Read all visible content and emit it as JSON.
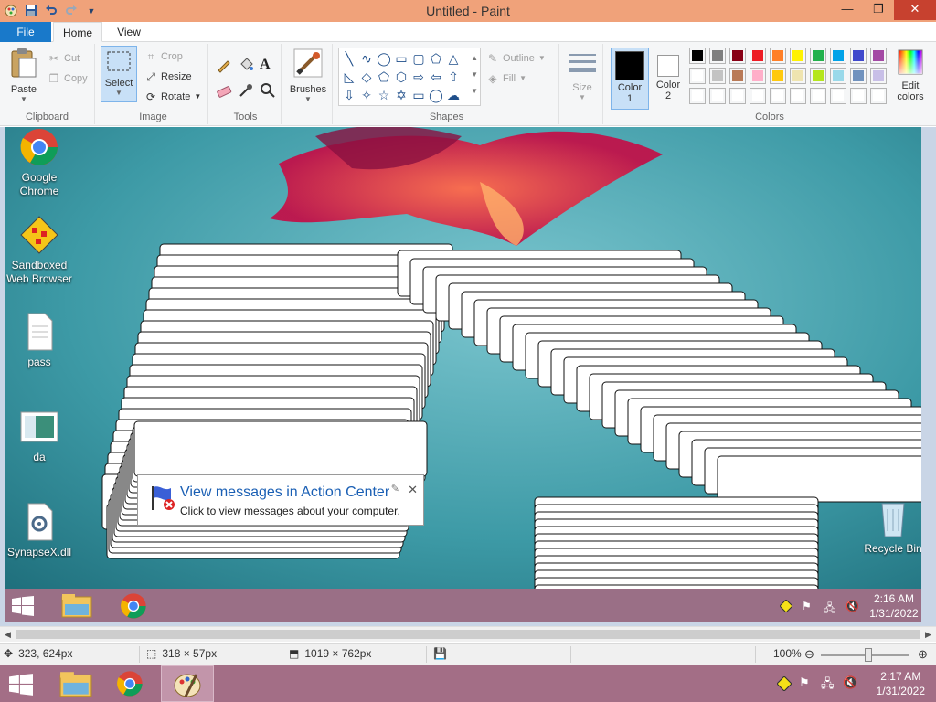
{
  "window": {
    "title": "Untitled - Paint",
    "minimize_glyph": "—",
    "maximize_glyph": "❐",
    "close_glyph": "✕"
  },
  "tabs": [
    {
      "label": "File"
    },
    {
      "label": "Home"
    },
    {
      "label": "View"
    }
  ],
  "ribbon": {
    "clipboard": {
      "label": "Clipboard",
      "paste": "Paste",
      "cut": "Cut",
      "copy": "Copy"
    },
    "image": {
      "label": "Image",
      "select": "Select",
      "crop": "Crop",
      "resize": "Resize",
      "rotate": "Rotate"
    },
    "tools": {
      "label": "Tools"
    },
    "brushes": {
      "label": "Brushes"
    },
    "shapes": {
      "label": "Shapes",
      "outline": "Outline",
      "fill": "Fill"
    },
    "size": {
      "label": "Size"
    },
    "color1": {
      "label": "Color",
      "num": "1",
      "value": "#000000"
    },
    "color2": {
      "label": "Color",
      "num": "2",
      "value": "#ffffff"
    },
    "colors": {
      "label": "Colors",
      "edit_label": "Edit",
      "edit_label2": "colors"
    },
    "palette_row1": [
      "#000000",
      "#7f7f7f",
      "#880015",
      "#ed1c24",
      "#ff7f27",
      "#fff200",
      "#22b14c",
      "#00a2e8",
      "#3f48cc",
      "#a349a4"
    ],
    "palette_row2": [
      "#ffffff",
      "#c3c3c3",
      "#b97a57",
      "#ffaec9",
      "#ffc90e",
      "#efe4b0",
      "#b5e61d",
      "#99d9ea",
      "#7092be",
      "#c8bfe7"
    ],
    "palette_row3": [
      "#ffffff",
      "#ffffff",
      "#ffffff",
      "#ffffff",
      "#ffffff",
      "#ffffff",
      "#ffffff",
      "#ffffff",
      "#ffffff",
      "#ffffff"
    ]
  },
  "desktop": {
    "icons": [
      {
        "line1": "Google",
        "line2": "Chrome"
      },
      {
        "line1": "Sandboxed",
        "line2": "Web Browser"
      },
      {
        "line1": "pass",
        "line2": ""
      },
      {
        "line1": "da",
        "line2": ""
      },
      {
        "line1": "SynapseX.dll",
        "line2": ""
      },
      {
        "line1": "Recycle Bin",
        "line2": ""
      }
    ],
    "toast": {
      "title": "View messages in Action Center",
      "subtitle": "Click to view messages about your computer."
    },
    "inner_clock": {
      "time": "2:16 AM",
      "date": "1/31/2022"
    }
  },
  "statusbar": {
    "cursor_pos": "323, 624px",
    "selection_size": "318 × 57px",
    "image_size": "1019 × 762px",
    "zoom": "100%"
  },
  "taskbar": {
    "time": "2:17 AM",
    "date": "1/31/2022"
  }
}
